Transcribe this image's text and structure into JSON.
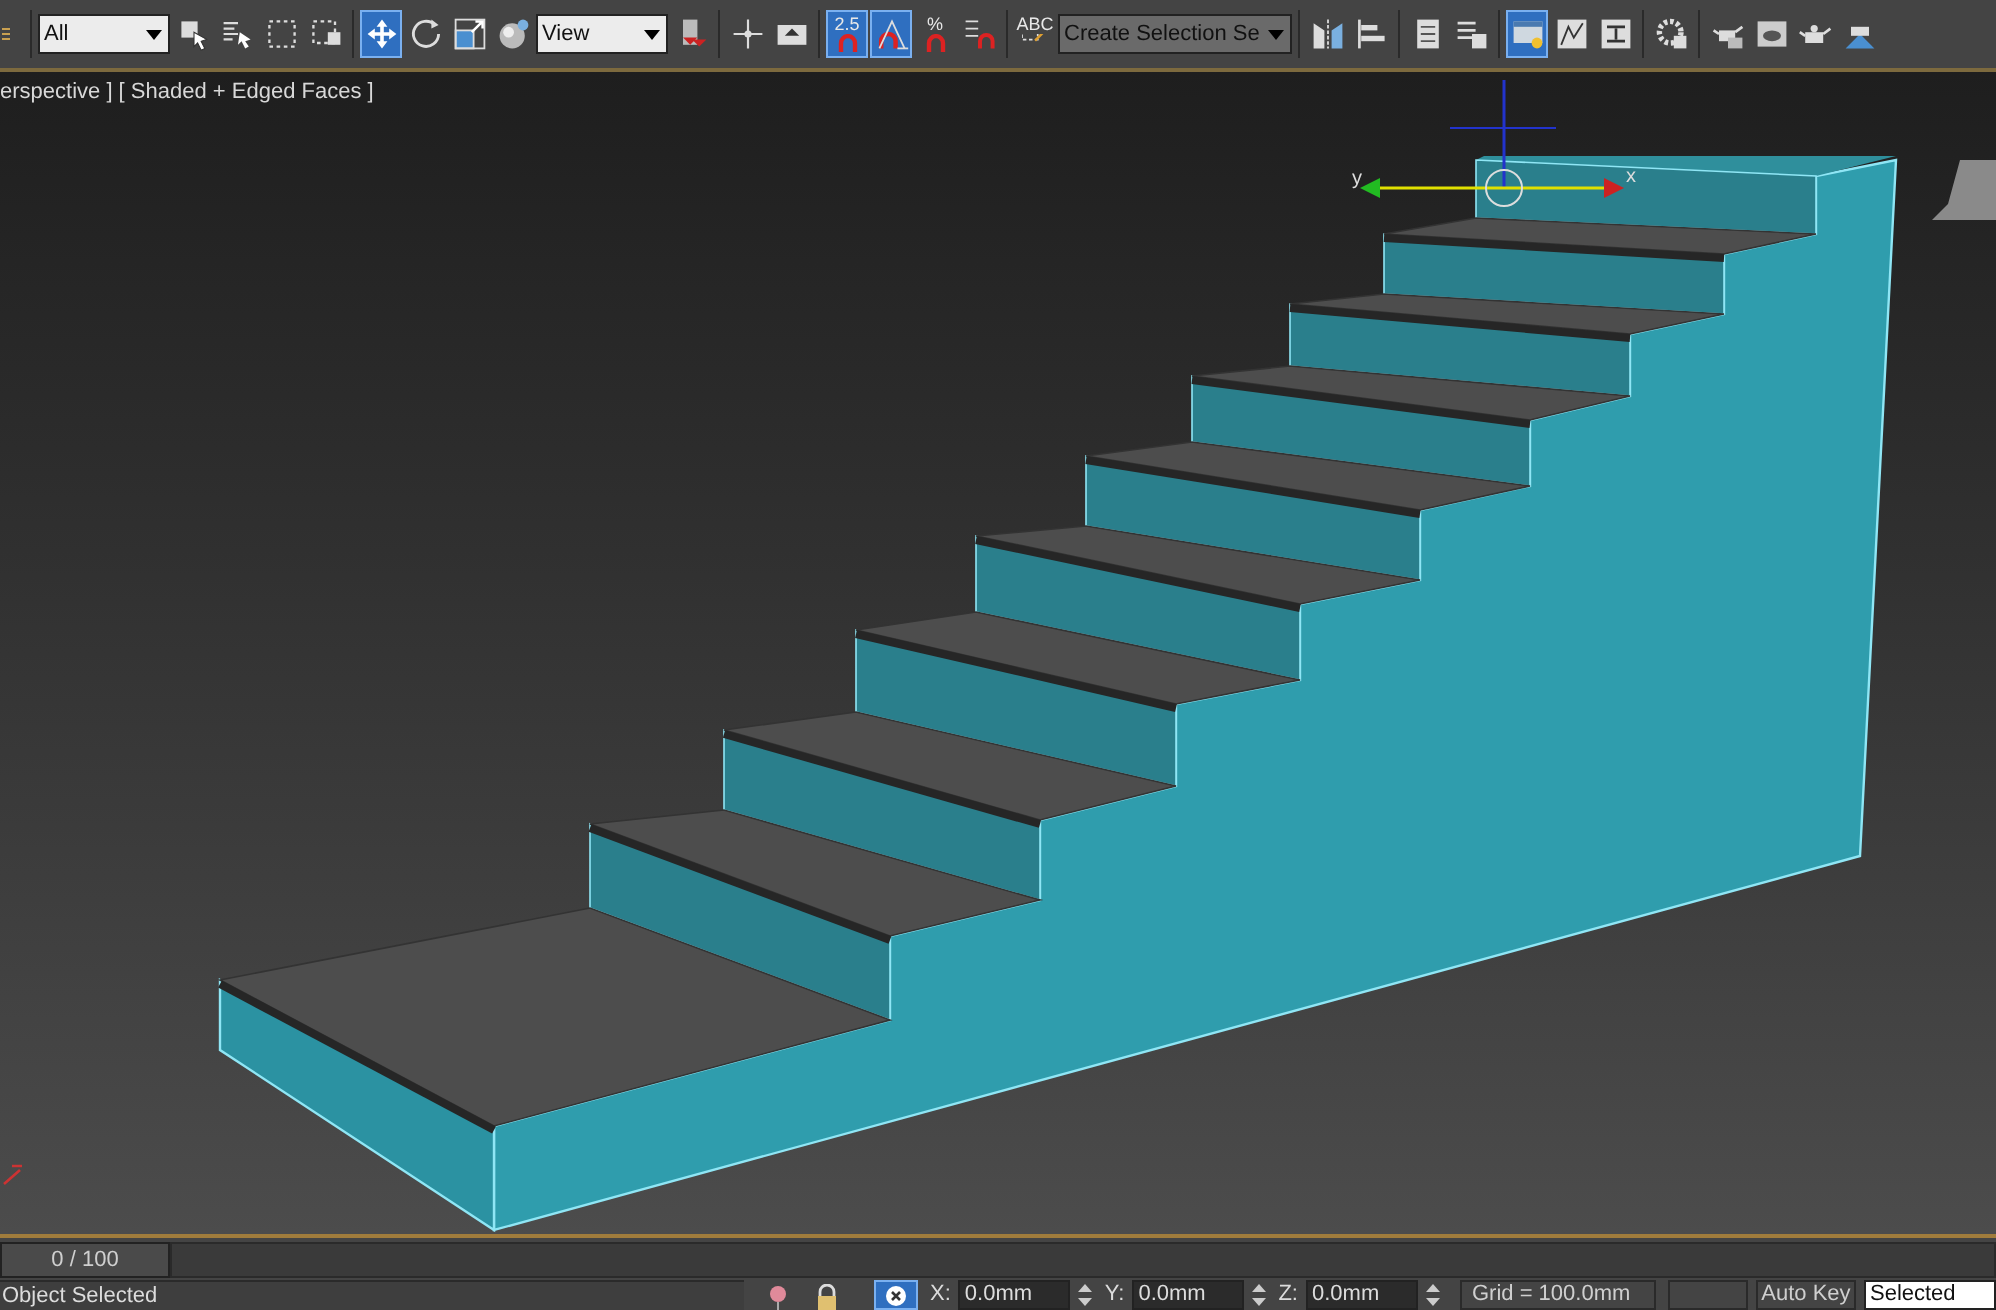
{
  "toolbar": [
    {
      "kind": "button",
      "selected": false
    },
    {
      "kind": "separator"
    },
    {
      "kind": "dropdown",
      "value": "All"
    },
    {
      "kind": "button",
      "selected": false
    },
    {
      "kind": "button",
      "selected": false
    },
    {
      "kind": "button",
      "selected": false
    },
    {
      "kind": "button",
      "selected": false
    },
    {
      "kind": "separator"
    },
    {
      "kind": "button",
      "selected": true
    },
    {
      "kind": "button",
      "selected": false
    },
    {
      "kind": "button",
      "selected": false
    },
    {
      "kind": "button",
      "selected": false
    },
    {
      "kind": "dropdown",
      "value": "View"
    },
    {
      "kind": "button",
      "selected": false
    },
    {
      "kind": "separator"
    },
    {
      "kind": "button",
      "selected": false
    },
    {
      "kind": "button",
      "selected": false
    },
    {
      "kind": "separator"
    },
    {
      "kind": "button",
      "selected": true,
      "label": "2.5"
    },
    {
      "kind": "button",
      "selected": true
    },
    {
      "kind": "button",
      "selected": false,
      "label": "%"
    },
    {
      "kind": "button",
      "selected": false
    },
    {
      "kind": "separator"
    },
    {
      "kind": "button",
      "selected": false,
      "label": "ABC"
    },
    {
      "kind": "named_selection",
      "value": "Create Selection Se"
    },
    {
      "kind": "separator"
    },
    {
      "kind": "button",
      "selected": false
    },
    {
      "kind": "button",
      "selected": false
    },
    {
      "kind": "separator"
    },
    {
      "kind": "button",
      "selected": false
    },
    {
      "kind": "button",
      "selected": false
    },
    {
      "kind": "separator"
    },
    {
      "kind": "button",
      "selected": true
    },
    {
      "kind": "button",
      "selected": false
    },
    {
      "kind": "button",
      "selected": false
    },
    {
      "kind": "separator"
    },
    {
      "kind": "button",
      "selected": false
    },
    {
      "kind": "separator"
    },
    {
      "kind": "button",
      "selected": false
    },
    {
      "kind": "button",
      "selected": false
    },
    {
      "kind": "button",
      "selected": false
    },
    {
      "kind": "button",
      "selected": false
    }
  ],
  "viewport": {
    "label": "erspective ] [ Shaded + Edged Faces ]",
    "gizmo": {
      "x_label": "x",
      "y_label": "y"
    }
  },
  "timeline": {
    "frame": "0 / 100"
  },
  "status_bar": {
    "prompt": "Object Selected",
    "coords": [
      {
        "axis": "X:",
        "value": "0.0mm"
      },
      {
        "axis": "Y:",
        "value": "0.0mm"
      },
      {
        "axis": "Z:",
        "value": "0.0mm"
      }
    ],
    "grid": "Grid = 100.0mm",
    "auto_key": "Auto Key",
    "key_mode": "Selected",
    "selection_lock": true
  }
}
